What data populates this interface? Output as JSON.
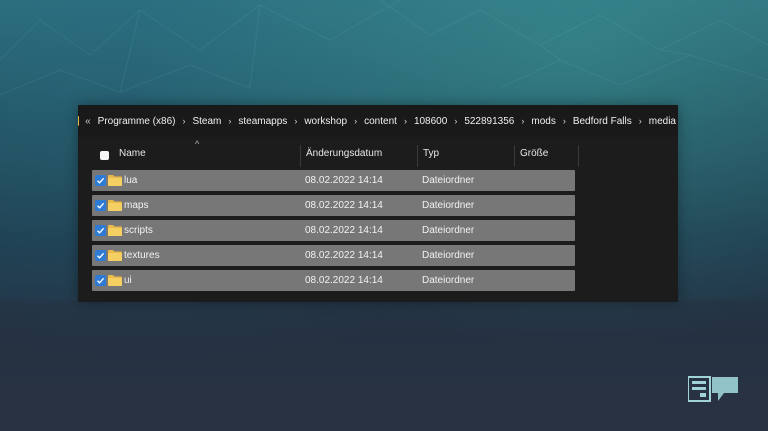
{
  "breadcrumb": {
    "overflow": "«",
    "segments": [
      "Programme (x86)",
      "Steam",
      "steamapps",
      "workshop",
      "content",
      "108600",
      "522891356",
      "mods",
      "Bedford Falls",
      "media"
    ],
    "separator": "›"
  },
  "columns": {
    "name": "Name",
    "date": "Änderungsdatum",
    "type": "Typ",
    "size": "Größe"
  },
  "rows": [
    {
      "name": "lua",
      "date": "08.02.2022 14:14",
      "type": "Dateiordner",
      "selected": true
    },
    {
      "name": "maps",
      "date": "08.02.2022 14:14",
      "type": "Dateiordner",
      "selected": true
    },
    {
      "name": "scripts",
      "date": "08.02.2022 14:14",
      "type": "Dateiordner",
      "selected": true
    },
    {
      "name": "textures",
      "date": "08.02.2022 14:14",
      "type": "Dateiordner",
      "selected": true
    },
    {
      "name": "ui",
      "date": "08.02.2022 14:14",
      "type": "Dateiordner",
      "selected": true
    }
  ],
  "colors": {
    "folder": "#e9b949",
    "checkbox": "#2e7bd6",
    "row_selected": "#777777",
    "window_bg": "#1c1c1c"
  },
  "icons": {
    "folder": "folder-icon",
    "checkbox": "checkbox-checked-icon",
    "sort": "sort-ascending-icon",
    "logo": "watermark-logo-icon"
  }
}
